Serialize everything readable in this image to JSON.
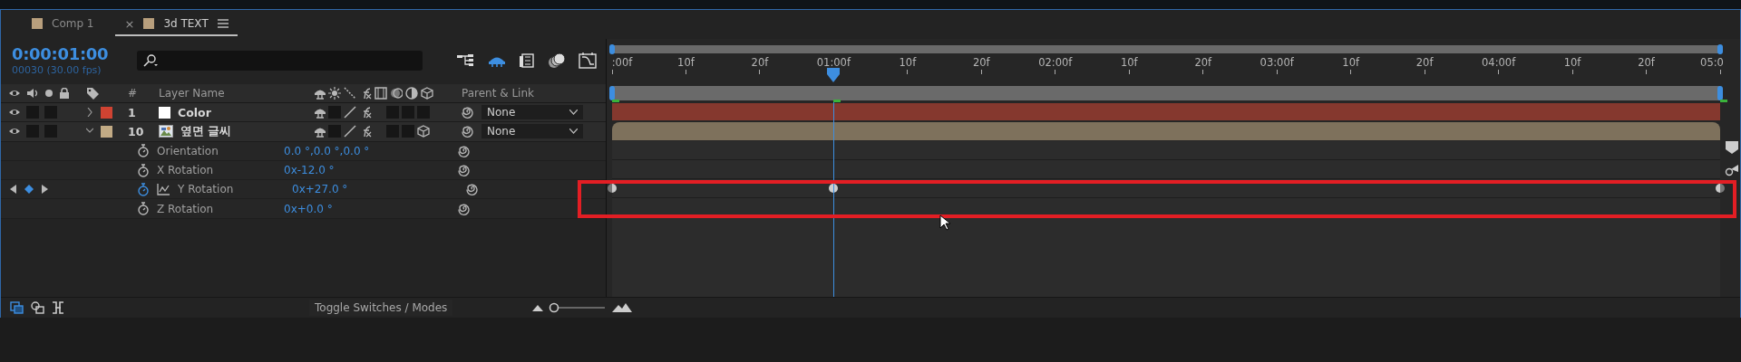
{
  "tabs": [
    {
      "label": "Comp 1",
      "color": "#b89f7d",
      "selected": false
    },
    {
      "label": "3d TEXT",
      "color": "#b89f7d",
      "selected": true,
      "close": "×"
    }
  ],
  "timecode": "0:00:01:00",
  "frames": "00030 (30.00 fps)",
  "columns": {
    "number": "#",
    "name": "Layer Name",
    "parent": "Parent & Link"
  },
  "layers": [
    {
      "number": "1",
      "name": "Color",
      "color": "#d04332",
      "kind": "solid",
      "expanded": false,
      "three_d": false,
      "parent": "None"
    },
    {
      "number": "10",
      "name": "옆면 글씨",
      "color": "#c2ab85",
      "kind": "image",
      "expanded": true,
      "three_d": true,
      "parent": "None",
      "properties": [
        {
          "name": "Orientation",
          "value": "0.0 °,0.0 °,0.0 °",
          "animated": false
        },
        {
          "name": "X Rotation",
          "value": "0x-12.0 °",
          "animated": false
        },
        {
          "name": "Y Rotation",
          "value": "0x+27.0 °",
          "animated": true,
          "keyframes": [
            {
              "kind": "half",
              "level": 0
            },
            {
              "kind": "full",
              "level": 0.2
            },
            {
              "kind": "half",
              "level": 1
            }
          ]
        },
        {
          "name": "Z Rotation",
          "value": "0x+0.0 °",
          "animated": false
        }
      ]
    }
  ],
  "ruler": [
    ":00f",
    "10f",
    "20f",
    "01:00f",
    "10f",
    "20f",
    "02:00f",
    "10f",
    "20f",
    "03:00f",
    "10f",
    "20f",
    "04:00f",
    "10f",
    "20f",
    "05:0"
  ],
  "playhead": {
    "level": 0.2
  },
  "toggle": "Toggle Switches / Modes",
  "zoom": {
    "level": 0
  }
}
